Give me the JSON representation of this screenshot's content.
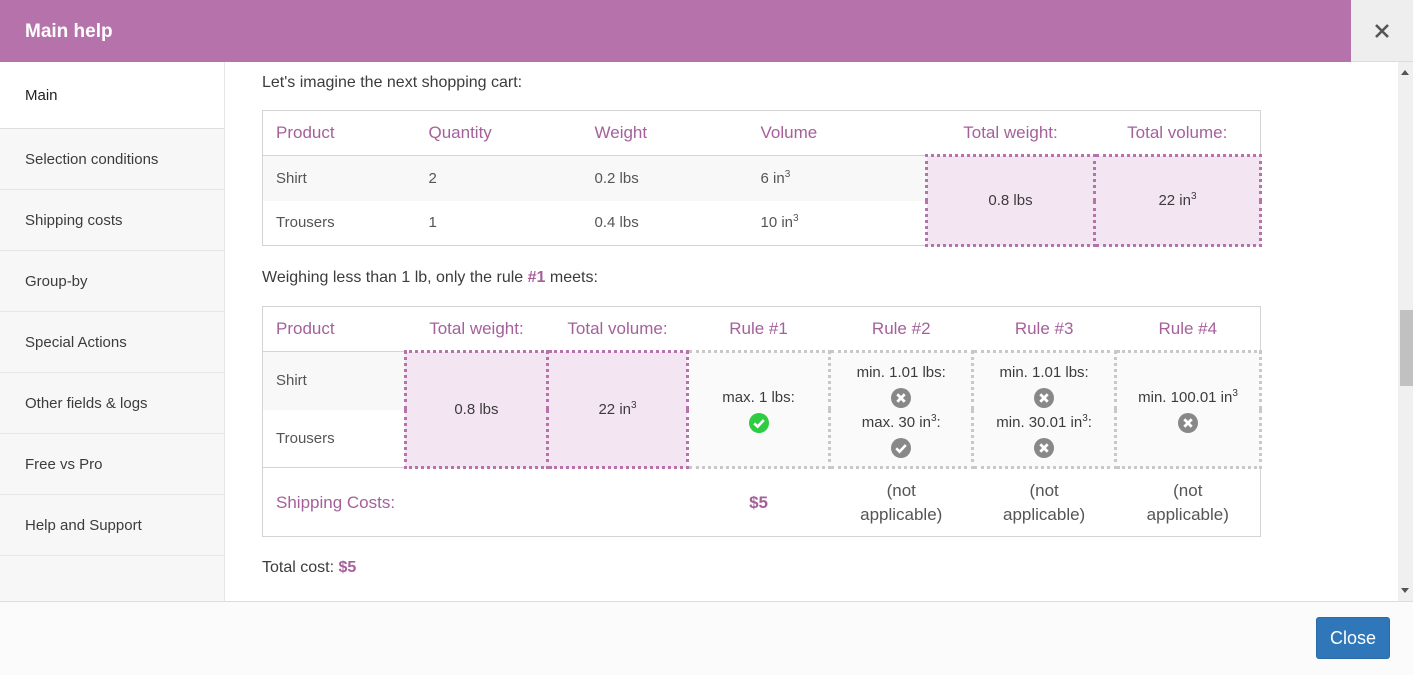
{
  "dialog": {
    "title": "Main help",
    "close_icon": "close-x-icon",
    "close_button_label": "Close"
  },
  "sidebar": {
    "items": [
      {
        "label": "Main",
        "active": true
      },
      {
        "label": "Selection conditions"
      },
      {
        "label": "Shipping costs"
      },
      {
        "label": "Group-by"
      },
      {
        "label": "Special Actions"
      },
      {
        "label": "Other fields & logs"
      },
      {
        "label": "Free vs Pro"
      },
      {
        "label": "Help and Support"
      }
    ]
  },
  "content": {
    "intro": "Let's imagine the next shopping cart:",
    "cart_table": {
      "headers": [
        "Product",
        "Quantity",
        "Weight",
        "Volume",
        "Total weight:",
        "Total volume:"
      ],
      "rows": [
        {
          "product": "Shirt",
          "quantity": "2",
          "weight": "0.2 lbs",
          "volume": "6 in",
          "volume_sup": "3"
        },
        {
          "product": "Trousers",
          "quantity": "1",
          "weight": "0.4 lbs",
          "volume": "10 in",
          "volume_sup": "3"
        }
      ],
      "total_weight": "0.8 lbs",
      "total_volume": "22 in",
      "total_volume_sup": "3"
    },
    "rule_sentence": {
      "before": "Weighing less than 1 lb, only the rule ",
      "highlight": "#1",
      "after": " meets:"
    },
    "rules_table": {
      "headers": [
        "Product",
        "Total weight:",
        "Total volume:",
        "Rule #1",
        "Rule #2",
        "Rule #3",
        "Rule #4"
      ],
      "products": [
        "Shirt",
        "Trousers"
      ],
      "total_weight": "0.8 lbs",
      "total_volume": "22 in",
      "total_volume_sup": "3",
      "rule1": {
        "cond1": "max. 1 lbs:",
        "cond1_status": "pass"
      },
      "rule2": {
        "cond1": "min. 1.01 lbs:",
        "cond1_status": "fail",
        "cond2": "max. 30 in",
        "cond2_sup": "3",
        "cond2_suffix": ":",
        "cond2_status": "pass-grey"
      },
      "rule3": {
        "cond1": "min. 1.01 lbs:",
        "cond1_status": "fail",
        "cond2": "min. 30.01 in",
        "cond2_sup": "3",
        "cond2_suffix": ":",
        "cond2_status": "fail"
      },
      "rule4": {
        "cond1": "min. 100.01 in",
        "cond1_sup": "3",
        "cond1_status": "fail"
      },
      "shipping_label": "Shipping Costs:",
      "shipping_values": [
        "$5",
        "(not applicable)",
        "(not applicable)",
        "(not applicable)"
      ]
    },
    "total_cost_label": "Total cost: ",
    "total_cost_value": "$5"
  },
  "colors": {
    "header": "#b673ab",
    "accent": "#a5609b",
    "highlight_bg": "#f4e5f2",
    "pass": "#2ecc40",
    "fail": "#888888",
    "button": "#2f77b8"
  }
}
